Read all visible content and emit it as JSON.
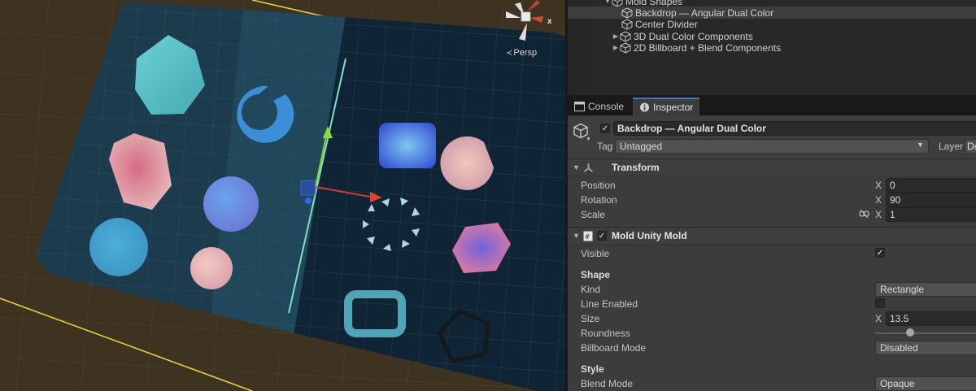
{
  "scene": {
    "persp_label": "Persp",
    "gizmo_axis_label": "x"
  },
  "hierarchy": {
    "items": [
      {
        "label": "Mold Shapes",
        "expanded": true
      },
      {
        "label": "Backdrop — Angular Dual Color",
        "selected": true
      },
      {
        "label": "Center Divider"
      },
      {
        "label": "3D Dual Color Components",
        "collapsed": true
      },
      {
        "label": "2D Billboard + Blend Components",
        "collapsed": true
      }
    ]
  },
  "tabs": [
    {
      "label": "Console",
      "active": false
    },
    {
      "label": "Inspector",
      "active": true
    }
  ],
  "inspector": {
    "object_name": "Backdrop — Angular Dual Color",
    "active": true,
    "tag_label": "Tag",
    "tag_value": "Untagged",
    "layer_label": "Layer",
    "layer_value": "De",
    "transform": {
      "title": "Transform",
      "position_label": "Position",
      "rotation_label": "Rotation",
      "scale_label": "Scale",
      "x_label": "X",
      "position_x": "0",
      "rotation_x": "90",
      "scale_x": "1"
    },
    "mold": {
      "title": "Mold Unity Mold",
      "visible_label": "Visible",
      "visible": true,
      "shape_section": "Shape",
      "kind_label": "Kind",
      "kind_value": "Rectangle",
      "line_enabled_label": "Line Enabled",
      "line_enabled": false,
      "size_label": "Size",
      "size_axis": "X",
      "size_x": "13.5",
      "roundness_label": "Roundness",
      "roundness": 0.33,
      "billboard_label": "Billboard Mode",
      "billboard_value": "Disabled",
      "style_section": "Style",
      "blend_label": "Blend Mode",
      "blend_value": "Opaque"
    }
  },
  "colors": {
    "scene_bg": "#3e3321",
    "board_left": "#1c3c4e",
    "board_right": "#0f2535",
    "yellow_bounds": "#e5d13b",
    "selection_blue": "#3d3d3d",
    "tab_accent": "#3a79bb"
  },
  "icons": [
    "cube-icon",
    "persp-icon",
    "console-icon",
    "info-icon",
    "transform-icon",
    "script-icon",
    "link-icon",
    "chevron-down-icon"
  ]
}
